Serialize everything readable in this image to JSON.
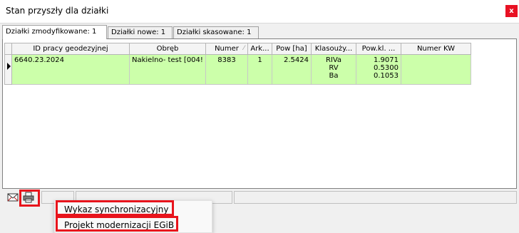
{
  "window": {
    "title": "Stan przyszły dla działki",
    "close_label": "x"
  },
  "tabs": [
    {
      "label": "Działki zmodyfikowane: 1"
    },
    {
      "label": "Działki nowe: 1"
    },
    {
      "label": "Działki skasowane: 1"
    }
  ],
  "grid": {
    "columns": [
      {
        "label": "ID pracy geodezyjnej"
      },
      {
        "label": "Obręb"
      },
      {
        "label": "Numer"
      },
      {
        "label": "Ark..."
      },
      {
        "label": "Pow [ha]"
      },
      {
        "label": "Klasouży..."
      },
      {
        "label": "Pow.kl. ..."
      },
      {
        "label": "Numer KW"
      }
    ],
    "sort_indicator": "⁄",
    "rows": [
      {
        "id_pracy": "6640.23.2024",
        "obreb": "Nakielno- test [004!",
        "numer": "8383",
        "arkusz": "1",
        "pow": "2.5424",
        "klasouzytki": [
          "RIVa",
          "RV",
          "Ba"
        ],
        "pow_kl": [
          "1.9071",
          "0.5300",
          "0.1053"
        ],
        "numer_kw": ""
      }
    ]
  },
  "toolbar": {
    "icons": [
      "envelope-icon",
      "printer-icon"
    ]
  },
  "context_menu": {
    "items": [
      {
        "label": "Wykaz synchronizacyjny"
      },
      {
        "label": "Projekt modernizacji EGiB"
      }
    ]
  },
  "colors": {
    "row_highlight": "#ccffaa",
    "annotation_red": "#e8141c",
    "close_red": "#e81123"
  }
}
